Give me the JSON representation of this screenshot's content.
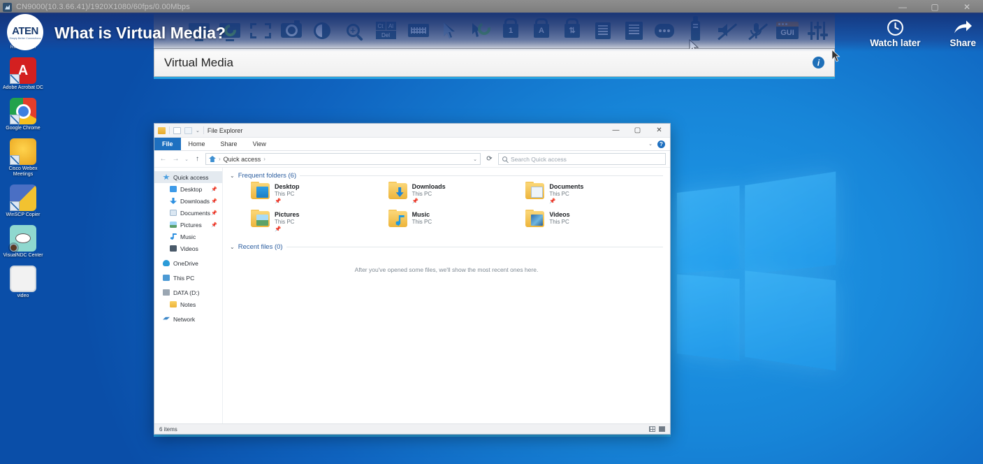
{
  "browser": {
    "window_title": "CN9000(10.3.66.41)/1920X1080/60fps/0.00Mbps",
    "favicon_name": "aten-kvm-favicon",
    "minimize": "—",
    "maximize": "▢",
    "close": "✕"
  },
  "youtube": {
    "logo_brand": "ATEN",
    "logo_sub": "Simply Better Connections",
    "video_title": "What is Virtual Media?",
    "actions": [
      {
        "label": "Watch later",
        "icon": "clock-icon"
      },
      {
        "label": "Share",
        "icon": "share-arrow-icon"
      }
    ]
  },
  "kvm_toolbar": {
    "icons": [
      {
        "name": "video-settings-icon",
        "title": "Video Settings"
      },
      {
        "name": "video-auto-sync-icon",
        "title": "Video Auto Sync"
      },
      {
        "name": "fullscreen-icon",
        "title": "Full Screen"
      },
      {
        "name": "screen-capture-icon",
        "title": "Screen Capture"
      },
      {
        "name": "brightness-contrast-icon",
        "title": "Brightness / Contrast"
      },
      {
        "name": "zoom-icon",
        "title": "Zoom"
      },
      {
        "name": "ctrl-alt-del-icon",
        "title": "Ctrl-Alt-Del"
      },
      {
        "name": "virtual-keyboard-icon",
        "title": "On-screen Keyboard"
      },
      {
        "name": "mouse-pointer-icon",
        "title": "Mouse Pointer Type"
      },
      {
        "name": "mouse-sync-icon",
        "title": "Mouse Sync Mode"
      },
      {
        "name": "num-lock-icon",
        "title": "Num Lock"
      },
      {
        "name": "caps-lock-icon",
        "title": "Caps Lock"
      },
      {
        "name": "scroll-lock-icon",
        "title": "Scroll Lock"
      },
      {
        "name": "macro-icon",
        "title": "Macros"
      },
      {
        "name": "message-board-icon",
        "title": "Message Board"
      },
      {
        "name": "chat-icon",
        "title": "Chat"
      },
      {
        "name": "virtual-media-usb-icon",
        "title": "Virtual Media"
      },
      {
        "name": "speaker-mute-icon",
        "title": "Speaker Mute"
      },
      {
        "name": "microphone-mute-icon",
        "title": "Microphone Mute"
      },
      {
        "name": "gui-icon",
        "title": "GUI"
      },
      {
        "name": "control-panel-sliders-icon",
        "title": "Control Panel"
      }
    ],
    "ctrl_alt_del": {
      "ctrl": "Ct",
      "alt": "Al",
      "del": "Del"
    },
    "num_lock_label": "1",
    "caps_lock_label": "A",
    "gui_label": "GUI"
  },
  "virtual_media_panel": {
    "title": "Virtual Media",
    "info_icon_label": "i"
  },
  "explorer": {
    "title": "File Explorer",
    "window_controls": {
      "minimize": "—",
      "maximize": "▢",
      "close": "✕"
    },
    "ribbon_tabs": [
      {
        "label": "File",
        "active": true
      },
      {
        "label": "Home",
        "active": false
      },
      {
        "label": "Share",
        "active": false
      },
      {
        "label": "View",
        "active": false
      }
    ],
    "ribbon_collapse": "⌄",
    "help_label": "?",
    "nav": {
      "back": "←",
      "forward": "→",
      "recent": "⌄",
      "up": "↑"
    },
    "address": {
      "crumb": "Quick access",
      "separator": "›",
      "caret": "⌄",
      "refresh": "⟳"
    },
    "search": {
      "placeholder": "Search Quick access"
    },
    "sidebar": [
      {
        "label": "Quick access",
        "icon": "ic-star",
        "selected": true,
        "pin": "",
        "indent": false
      },
      {
        "label": "Desktop",
        "icon": "ic-desktop",
        "selected": false,
        "pin": "📌",
        "indent": true
      },
      {
        "label": "Downloads",
        "icon": "ic-dl",
        "selected": false,
        "pin": "📌",
        "indent": true
      },
      {
        "label": "Documents",
        "icon": "ic-docs",
        "selected": false,
        "pin": "📌",
        "indent": true
      },
      {
        "label": "Pictures",
        "icon": "ic-pics",
        "selected": false,
        "pin": "📌",
        "indent": true
      },
      {
        "label": "Music",
        "icon": "ic-music",
        "selected": false,
        "pin": "",
        "indent": true
      },
      {
        "label": "Videos",
        "icon": "ic-videos",
        "selected": false,
        "pin": "",
        "indent": true
      },
      {
        "label": "OneDrive",
        "icon": "ic-onedrive",
        "selected": false,
        "pin": "",
        "indent": false
      },
      {
        "label": "This PC",
        "icon": "ic-thispc",
        "selected": false,
        "pin": "",
        "indent": false
      },
      {
        "label": "DATA (D:)",
        "icon": "ic-drive",
        "selected": false,
        "pin": "",
        "indent": false
      },
      {
        "label": "Notes",
        "icon": "ic-folder",
        "selected": false,
        "pin": "",
        "indent": true
      },
      {
        "label": "Network",
        "icon": "ic-network",
        "selected": false,
        "pin": "",
        "indent": false
      }
    ],
    "frequent_folders": {
      "heading": "Frequent folders (6)",
      "chevron": "⌄",
      "items": [
        {
          "name": "Desktop",
          "location": "This PC",
          "pin": "📌",
          "inner": "in-desktop"
        },
        {
          "name": "Downloads",
          "location": "This PC",
          "pin": "📌",
          "inner": "in-dl"
        },
        {
          "name": "Documents",
          "location": "This PC",
          "pin": "📌",
          "inner": "in-docs"
        },
        {
          "name": "Pictures",
          "location": "This PC",
          "pin": "📌",
          "inner": "in-pics"
        },
        {
          "name": "Music",
          "location": "This PC",
          "pin": "",
          "inner": "in-music"
        },
        {
          "name": "Videos",
          "location": "This PC",
          "pin": "",
          "inner": "in-videos"
        }
      ]
    },
    "recent_files": {
      "heading": "Recent files (0)",
      "chevron": "⌄",
      "empty_message": "After you've opened some files, we'll show the most recent ones here."
    },
    "status": {
      "item_count": "6 items",
      "view_grid": "",
      "view_list": ""
    }
  },
  "desktop_icons": [
    {
      "label": "Recycle Bin",
      "icon": "recycle-bin-icon",
      "shortcut": false
    },
    {
      "label": "Adobe Acrobat DC",
      "icon": "adobe-acrobat-icon",
      "shortcut": true,
      "glyph": "A"
    },
    {
      "label": "Google Chrome",
      "icon": "google-chrome-icon",
      "shortcut": true,
      "glyph": ""
    },
    {
      "label": "Cisco Webex Meetings",
      "icon": "cisco-webex-icon",
      "shortcut": true,
      "glyph": ""
    },
    {
      "label": "WinSCP Copier",
      "icon": "winscp-icon",
      "shortcut": true,
      "glyph": ""
    },
    {
      "label": "VisualNDC Center",
      "icon": "viewer-eye-icon",
      "shortcut": true,
      "glyph": ""
    },
    {
      "label": "video",
      "icon": "video-file-icon",
      "shortcut": false,
      "glyph": ""
    }
  ],
  "colors": {
    "accent_blue": "#29a3e0",
    "kvm_icon_blue": "#2d5572",
    "explorer_tab_blue": "#1e70c0",
    "desktop_blue": "#0f63bf"
  }
}
